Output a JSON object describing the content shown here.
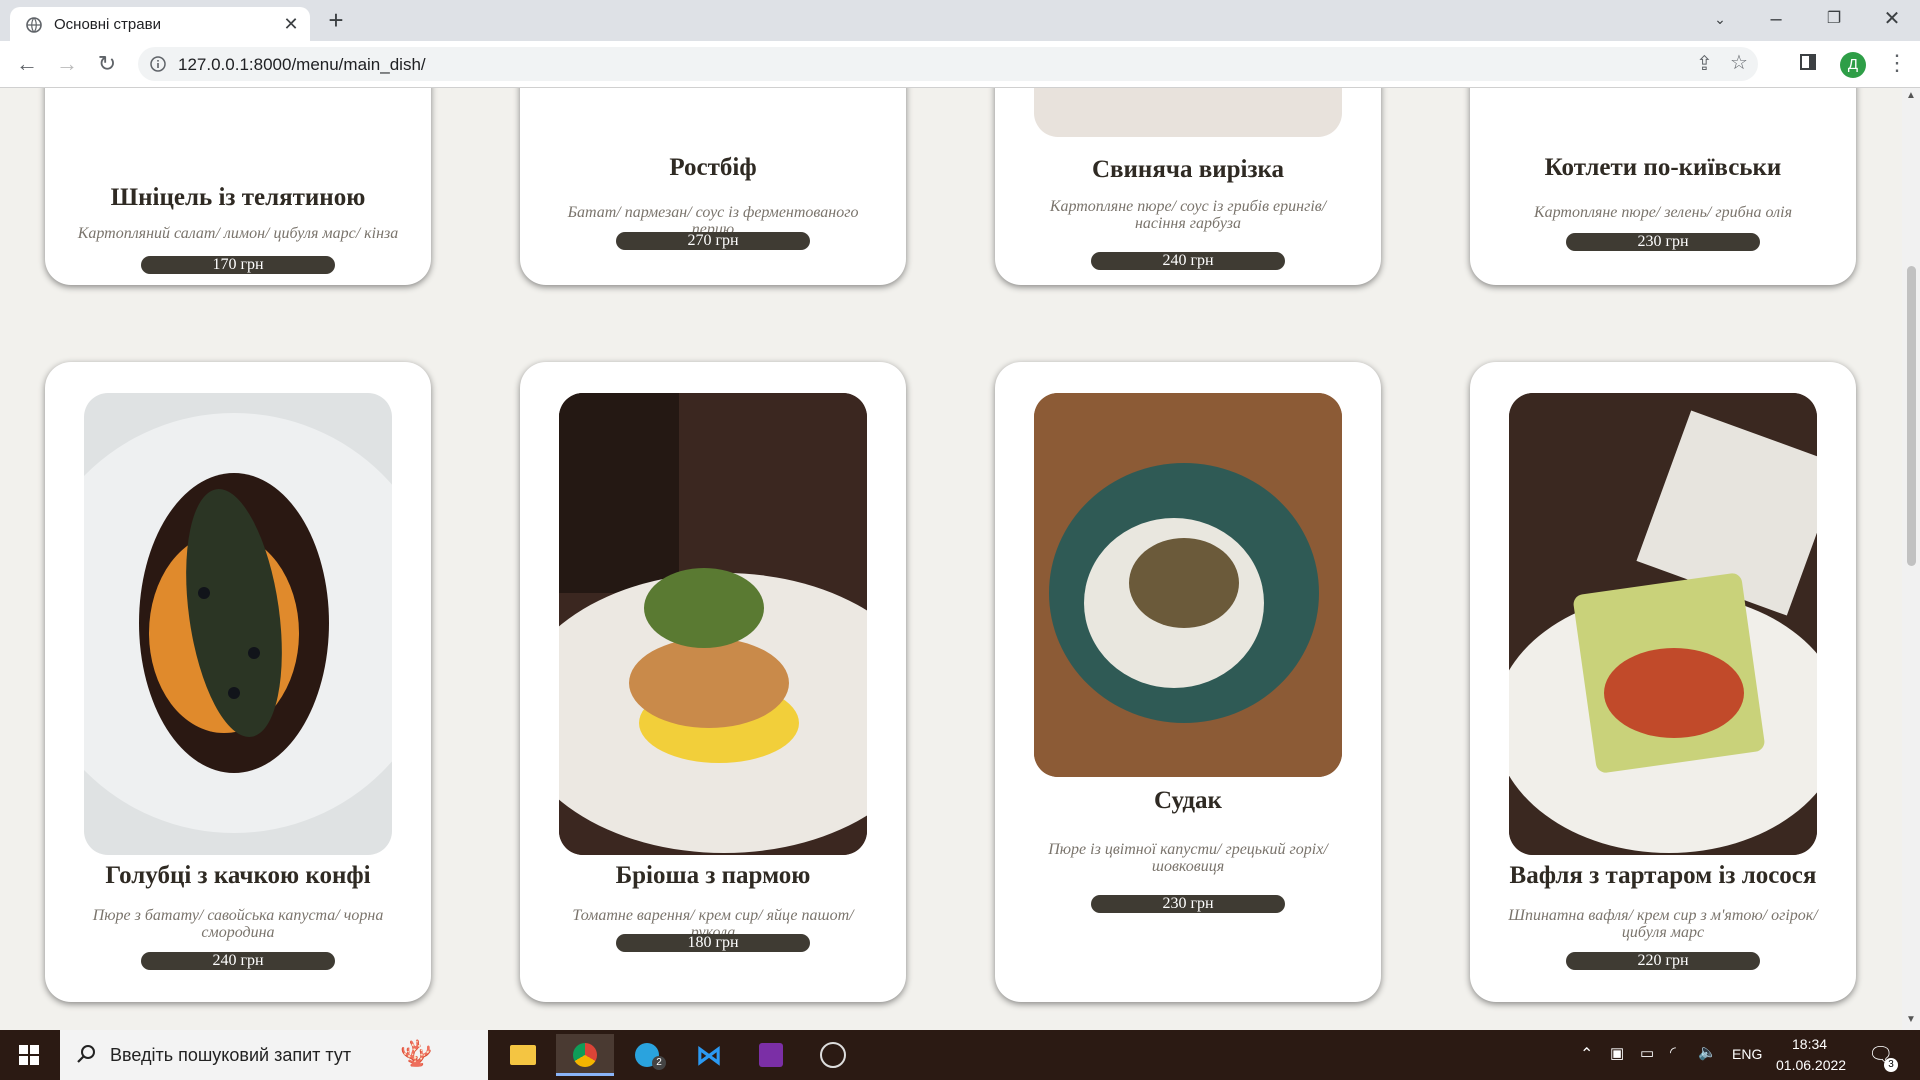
{
  "browser": {
    "tab_title": "Основні страви",
    "url": "127.0.0.1:8000/menu/main_dish/",
    "avatar_letter": "Д"
  },
  "menu": {
    "top_row": [
      {
        "name": "Шніцель із телятиною",
        "desc": "Картопляний салат/ лимон/ цибуля марс/ кінза",
        "price": "170 грн"
      },
      {
        "name": "Ростбіф",
        "desc": "Батат/ пармезан/ соус із ферментованого перцю",
        "price": "270 грн"
      },
      {
        "name": "Свиняча вирізка",
        "desc": "Картопляне пюре/ соус із грибів ерингів/ насіння гарбуза",
        "price": "240 грн"
      },
      {
        "name": "Котлети по-київськи",
        "desc": "Картопляне пюре/ зелень/ грибна олія",
        "price": "230 грн"
      }
    ],
    "bottom_row": [
      {
        "name": "Голубці з качкою конфі",
        "desc": "Пюре з батату/ савойська капуста/ чорна смородина",
        "price": "240 грн"
      },
      {
        "name": "Бріоша з пармою",
        "desc": "Томатне варення/ крем сир/ яйце пашот/ рукола",
        "price": "180 грн"
      },
      {
        "name": "Судак",
        "desc": "Пюре із цвітної капусти/ грецький горіх/ шовковиця",
        "price": "230 грн"
      },
      {
        "name": "Вафля з тартаром із лосося",
        "desc": "Шпинатна вафля/ крем сир з м'ятою/ огірок/ цибуля марс",
        "price": "220 грн"
      }
    ]
  },
  "taskbar": {
    "search_placeholder": "Введіть пошуковий запит тут",
    "lang": "ENG",
    "time": "18:34",
    "date": "01.06.2022",
    "notification_count": "3",
    "telegram_badge": "2"
  }
}
